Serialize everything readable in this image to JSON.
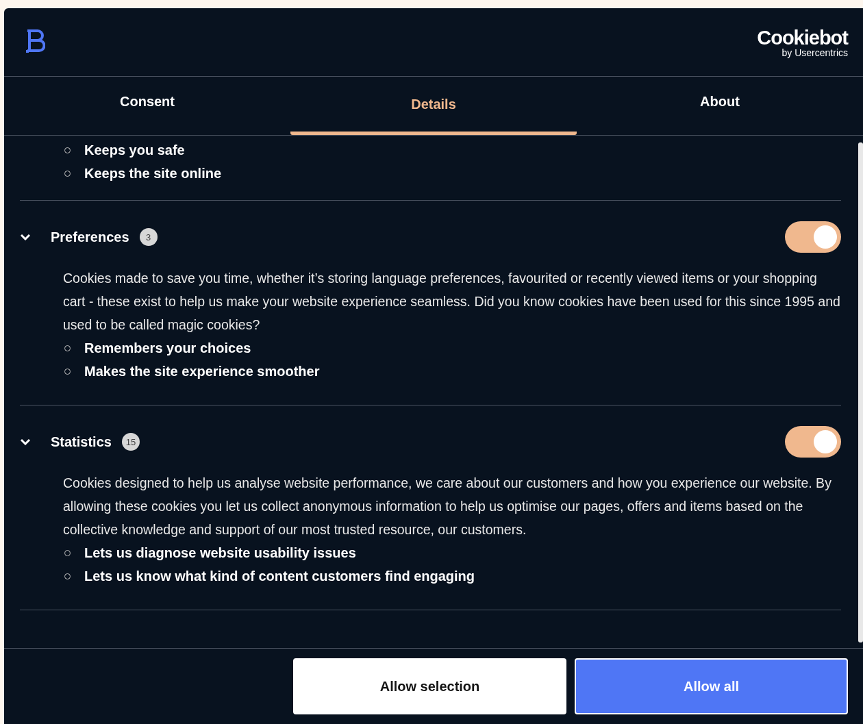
{
  "header": {
    "brand_name": "Cookiebot",
    "brand_tagline": "by Usercentrics"
  },
  "tabs": [
    {
      "label": "Consent",
      "selected": false
    },
    {
      "label": "Details",
      "selected": true
    },
    {
      "label": "About",
      "selected": false
    }
  ],
  "top_bullets": [
    "Keeps you safe",
    "Keeps the site online"
  ],
  "categories": [
    {
      "title": "Preferences",
      "count": "3",
      "expanded": true,
      "on": true,
      "description": "Cookies made to save you time, whether it’s storing language preferences, favourited or recently viewed items or your shopping cart - these exist to help us make your website experience seamless. Did you know cookies have been used for this since 1995 and used to be called magic cookies?",
      "bullets": [
        "Remembers your choices",
        "Makes the site experience smoother"
      ]
    },
    {
      "title": "Statistics",
      "count": "15",
      "expanded": true,
      "on": true,
      "description": "Cookies designed to help us analyse website performance, we care about our customers and how you experience our website. By allowing these cookies you let us collect anonymous information to help us optimise our pages, offers and items based on the collective knowledge and support of our most trusted resource, our customers.",
      "bullets": [
        "Lets us diagnose website usability issues",
        "Lets us know what kind of content customers find engaging"
      ]
    }
  ],
  "buttons": [
    {
      "label": "Allow selection",
      "kind": "secondary"
    },
    {
      "label": "Allow all",
      "kind": "primary"
    }
  ]
}
